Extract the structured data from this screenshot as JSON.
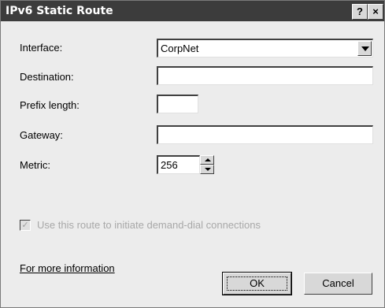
{
  "window": {
    "title": "IPv6 Static Route"
  },
  "titlebar": {
    "help_glyph": "?",
    "close_glyph": "×"
  },
  "form": {
    "interface_label": "Interface:",
    "interface_value": "CorpNet",
    "destination_label": "Destination:",
    "destination_value": "",
    "prefix_label": "Prefix length:",
    "prefix_value": "",
    "gateway_label": "Gateway:",
    "gateway_value": "",
    "metric_label": "Metric:",
    "metric_value": "256"
  },
  "demand_dial": {
    "label": "Use this route to initiate demand-dial connections",
    "checked": true
  },
  "footer": {
    "more_info_link": "For more information",
    "ok_label": "OK",
    "cancel_label": "Cancel"
  },
  "colors": {
    "titlebar": "#3c3c3c",
    "dialog_bg": "#ececec",
    "disabled_text": "#a8a8a8"
  }
}
